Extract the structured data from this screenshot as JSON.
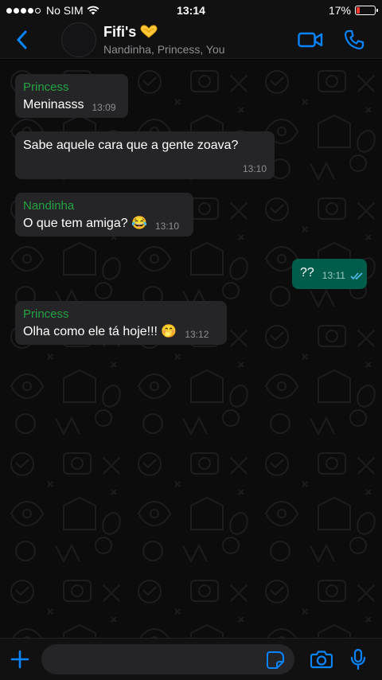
{
  "status_bar": {
    "carrier": "No SIM",
    "time": "13:14",
    "battery_percent": "17%",
    "battery_level": 0.17,
    "battery_color": "#ff3b30",
    "signal_dots_filled": 4,
    "signal_dots_total": 5
  },
  "header": {
    "title": "Fifi's",
    "title_emoji": "heart-hands-icon",
    "subtitle": "Nandinha, Princess, You",
    "accent": "#0a84ff",
    "icons": [
      "back-chevron-icon",
      "video-call-icon",
      "phone-call-icon"
    ]
  },
  "messages": [
    {
      "sender": "Princess",
      "text": "Meninasss",
      "time": "13:09"
    },
    {
      "sender": "",
      "text": "Sabe aquele cara que a gente zoava?",
      "time": "13:10"
    },
    {
      "sender": "Nandinha",
      "text": "O que tem amiga? 😂",
      "time": "13:10"
    },
    {
      "sender": "",
      "text": "??",
      "time": "13:11",
      "read": true
    },
    {
      "sender": "Princess",
      "text": "Olha como ele tá hoje!!! 🤭",
      "time": "13:12"
    }
  ],
  "colors": {
    "sender_name": "#25a244",
    "incoming_bubble": "#252527",
    "outgoing_bubble": "#005c4b",
    "read_ticks": "#53bdeb"
  },
  "input_bar": {
    "icons": [
      "plus-icon",
      "sticker-icon",
      "camera-icon",
      "microphone-icon"
    ],
    "message_value": ""
  }
}
